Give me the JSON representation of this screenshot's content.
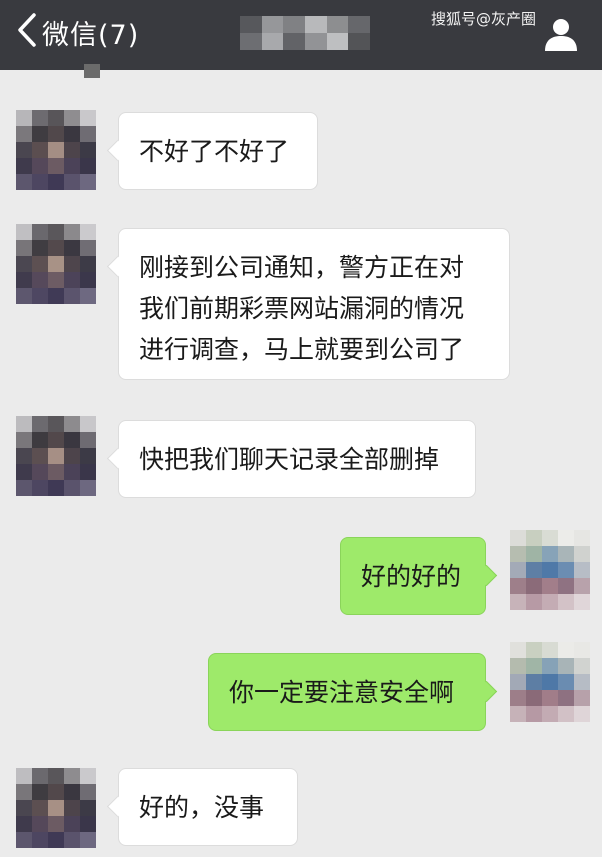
{
  "header": {
    "back_label": "微信(7)",
    "watermark": "搜狐号@灰产圈",
    "bar_color": "#393a3f"
  },
  "icons": {
    "back": "chevron-left-icon",
    "profile": "person-icon"
  },
  "colors": {
    "background": "#ebebeb",
    "incoming_bubble": "#ffffff",
    "outgoing_bubble": "#9eea6a"
  },
  "messages": [
    {
      "side": "left",
      "text": "不好了不好了"
    },
    {
      "side": "left",
      "text": "刚接到公司通知，警方正在对\n我们前期彩票网站漏洞的情况\n进行调查，马上就要到公司了"
    },
    {
      "side": "left",
      "text": "快把我们聊天记录全部删掉"
    },
    {
      "side": "right",
      "text": "好的好的"
    },
    {
      "side": "right",
      "text": "你一定要注意安全啊"
    },
    {
      "side": "left",
      "text": "好的，没事"
    }
  ]
}
